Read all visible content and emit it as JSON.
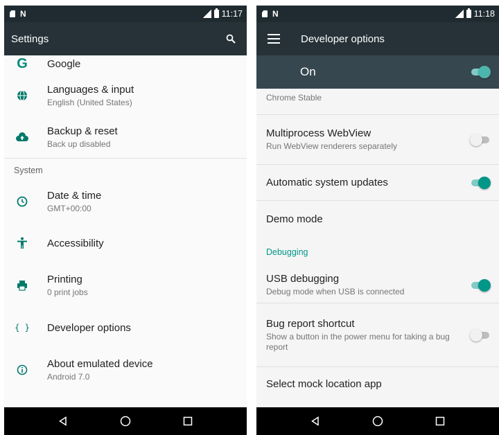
{
  "left": {
    "status_time": "11:17",
    "toolbar_title": "Settings",
    "items_top": [
      {
        "title": "Google",
        "subtitle": "",
        "icon": "google-icon"
      },
      {
        "title": "Languages & input",
        "subtitle": "English (United States)",
        "icon": "globe-icon"
      },
      {
        "title": "Backup & reset",
        "subtitle": "Back up disabled",
        "icon": "cloud-upload-icon"
      }
    ],
    "section": "System",
    "items_system": [
      {
        "title": "Date & time",
        "subtitle": "GMT+00:00",
        "icon": "clock-icon"
      },
      {
        "title": "Accessibility",
        "subtitle": "",
        "icon": "accessibility-icon"
      },
      {
        "title": "Printing",
        "subtitle": "0 print jobs",
        "icon": "printer-icon"
      },
      {
        "title": "Developer options",
        "subtitle": "",
        "icon": "code-braces-icon"
      },
      {
        "title": "About emulated device",
        "subtitle": "Android 7.0",
        "icon": "info-icon"
      }
    ]
  },
  "right": {
    "status_time": "11:18",
    "toolbar_title": "Developer options",
    "master_label": "On",
    "master_on": true,
    "partial_row_sub": "Chrome Stable",
    "rows": [
      {
        "title": "Multiprocess WebView",
        "subtitle": "Run WebView renderers separately",
        "toggle": false
      },
      {
        "title": "Automatic system updates",
        "subtitle": "",
        "toggle": true
      },
      {
        "title": "Demo mode",
        "subtitle": ""
      }
    ],
    "section": "Debugging",
    "debug_rows": [
      {
        "title": "USB debugging",
        "subtitle": "Debug mode when USB is connected",
        "toggle": true
      },
      {
        "title": "Bug report shortcut",
        "subtitle": "Show a button in the power menu for taking a bug report",
        "toggle": false
      },
      {
        "title": "Select mock location app",
        "subtitle": ""
      }
    ]
  },
  "colors": {
    "statusbar": "#1f2b30",
    "toolbar": "#263238",
    "master_bar": "#37474f",
    "accent": "#009688",
    "icon_teal": "#00796b"
  }
}
